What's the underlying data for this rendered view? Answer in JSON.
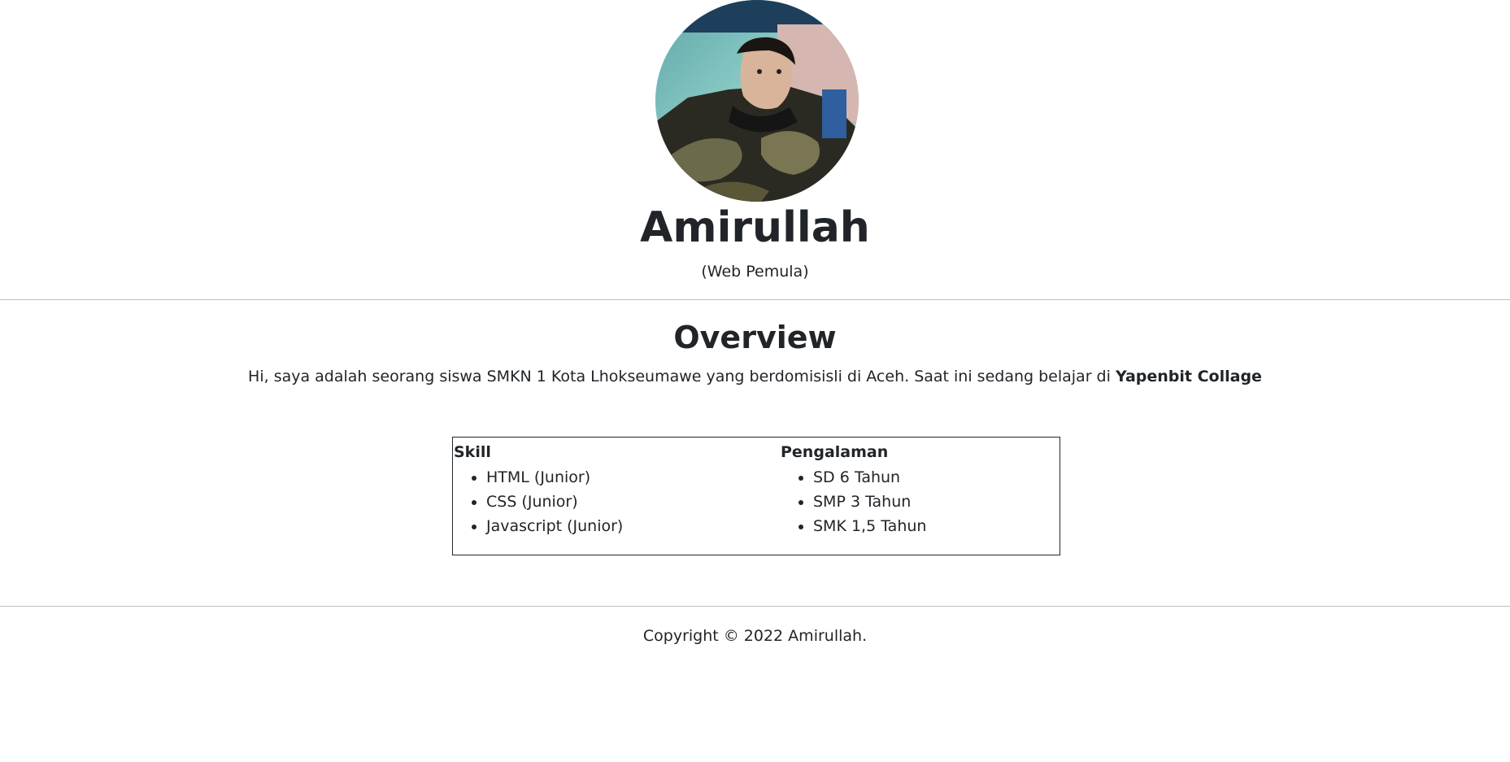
{
  "profile": {
    "name": "Amirullah",
    "role": "(Web Pemula)",
    "photo_alt": "profile-photo"
  },
  "overview": {
    "title": "Overview",
    "text": "Hi, saya adalah seorang siswa SMKN 1 Kota Lhokseumawe yang berdomisisli di Aceh. Saat ini sedang belajar di ",
    "highlight": "Yapenbit Collage"
  },
  "skill": {
    "heading": "Skill",
    "items": [
      "HTML (Junior)",
      "CSS (Junior)",
      "Javascript (Junior)"
    ]
  },
  "experience": {
    "heading": "Pengalaman",
    "items": [
      "SD 6 Tahun",
      "SMP 3 Tahun",
      "SMK 1,5 Tahun"
    ]
  },
  "footer": {
    "copyright": "Copyright © 2022 Amirullah."
  }
}
